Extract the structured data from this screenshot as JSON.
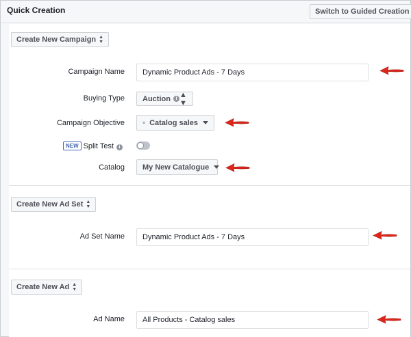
{
  "header": {
    "title": "Quick Creation",
    "switch_button": "Switch to Guided Creation"
  },
  "campaign": {
    "create_button": "Create New Campaign",
    "name_label": "Campaign Name",
    "name_value": "Dynamic Product Ads - 7 Days",
    "buying_type_label": "Buying Type",
    "buying_type_value": "Auction",
    "objective_label": "Campaign Objective",
    "objective_value": "Catalog sales",
    "objective_icon": "cart-icon",
    "new_badge": "NEW",
    "split_test_label": "Split Test",
    "split_test_on": false,
    "catalog_label": "Catalog",
    "catalog_value": "My New Catalogue"
  },
  "ad_set": {
    "create_button": "Create New Ad Set",
    "name_label": "Ad Set Name",
    "name_value": "Dynamic Product Ads - 7 Days"
  },
  "ad": {
    "create_button": "Create New Ad",
    "name_label": "Ad Name",
    "name_value": "All Products - Catalog sales"
  },
  "colors": {
    "annotation_arrow": "#e0261b",
    "badge_blue": "#4267b2"
  }
}
